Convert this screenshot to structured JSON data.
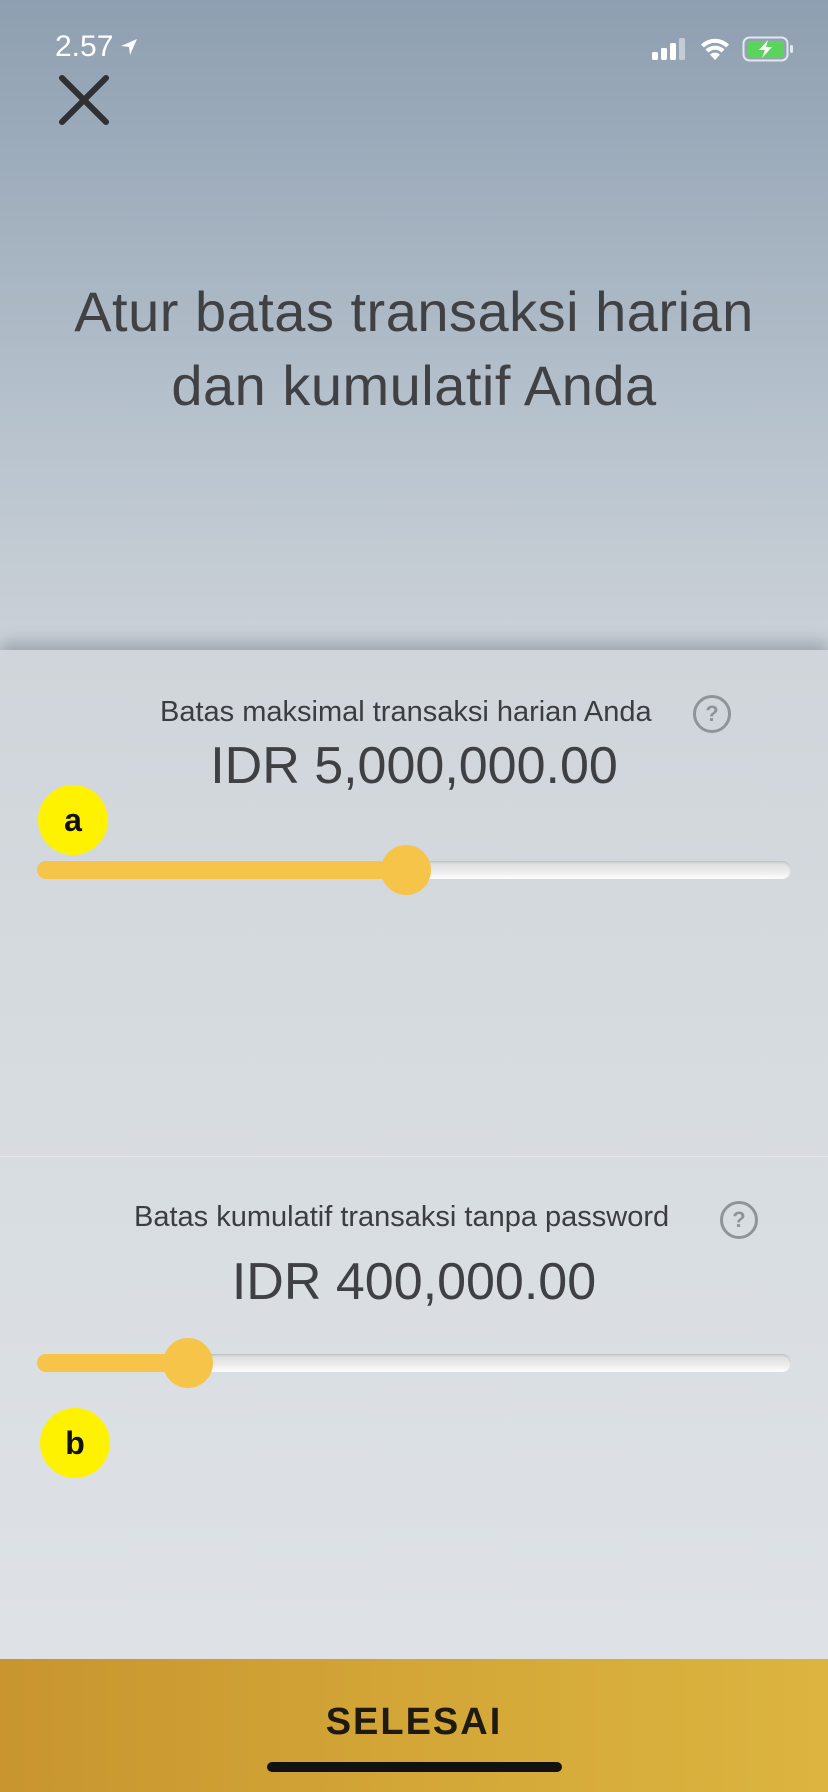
{
  "status_bar": {
    "time": "2.57",
    "icons": [
      "location-arrow-icon",
      "signal-icon",
      "wifi-icon",
      "battery-charging-icon"
    ],
    "battery_color": "#5bd45b"
  },
  "header": {
    "close_icon": "close-icon",
    "title": "Atur batas transaksi harian dan kumulatif Anda"
  },
  "limits": [
    {
      "label": "Batas maksimal transaksi harian Anda",
      "value": "IDR 5,000,000.00",
      "help_icon": "help-icon",
      "help_glyph": "?",
      "slider_level": 0.49,
      "marker": "a"
    },
    {
      "label": "Batas kumulatif transaksi tanpa password",
      "value": "IDR 400,000.00",
      "help_icon": "help-icon",
      "help_glyph": "?",
      "slider_level": 0.2,
      "marker": "b"
    }
  ],
  "footer": {
    "done_label": "SELESAI"
  },
  "colors": {
    "accent": "#f5c449",
    "marker": "#fff200",
    "button": "#d4a838"
  }
}
